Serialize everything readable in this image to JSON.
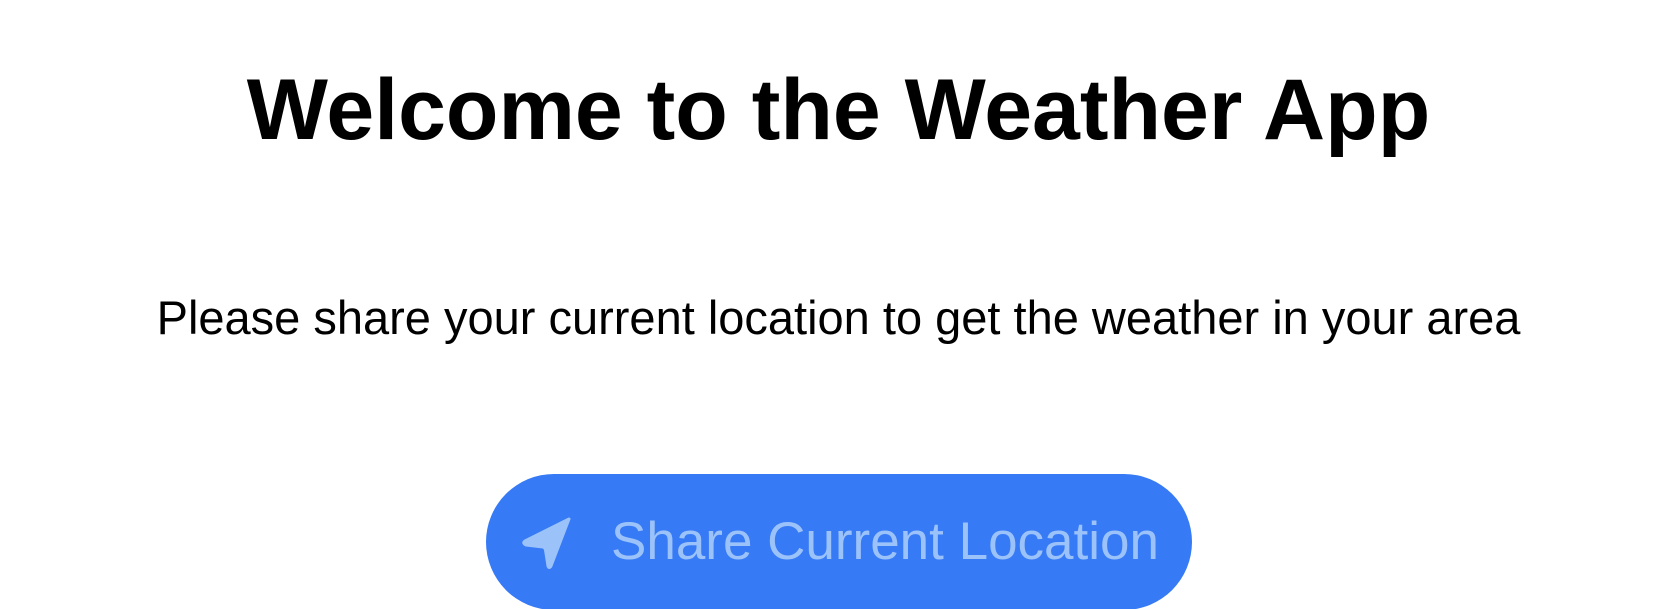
{
  "welcome": {
    "title": "Welcome to the Weather App",
    "message": "Please share your current location to get the weather in your area"
  },
  "share_button": {
    "label": "Share Current Location",
    "icon": "location-arrow-icon",
    "background_color": "#367AF5",
    "content_color": "#9CC2FA"
  }
}
